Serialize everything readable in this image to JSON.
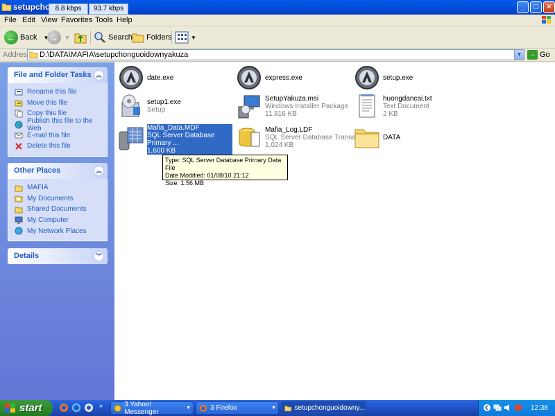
{
  "window": {
    "title": "setupchong",
    "speed_down": "8.8 kbps",
    "speed_up": "93.7 kbps"
  },
  "menu": [
    "File",
    "Edit",
    "View",
    "Favorites",
    "Tools",
    "Help"
  ],
  "toolbar": {
    "back": "Back",
    "search": "Search",
    "folders": "Folders"
  },
  "address": {
    "label": "Address",
    "path": "D:\\DATA\\MAFIA\\setupchonguoidownyakuza",
    "go": "Go"
  },
  "file_tasks": {
    "title": "File and Folder Tasks",
    "items": [
      "Rename this file",
      "Move this file",
      "Copy this file",
      "Publish this file to the Web",
      "E-mail this file",
      "Delete this file"
    ]
  },
  "other_places": {
    "title": "Other Places",
    "items": [
      "MAFIA",
      "My Documents",
      "Shared Documents",
      "My Computer",
      "My Network Places"
    ]
  },
  "details": {
    "title": "Details"
  },
  "files": [
    {
      "name": "date.exe",
      "sub1": "",
      "sub2": ""
    },
    {
      "name": "express.exe",
      "sub1": "",
      "sub2": ""
    },
    {
      "name": "setup.exe",
      "sub1": "",
      "sub2": ""
    },
    {
      "name": "setup1.exe",
      "sub1": "Setup",
      "sub2": ""
    },
    {
      "name": "SetupYakuza.msi",
      "sub1": "Windows Installer Package",
      "sub2": "11,816 KB"
    },
    {
      "name": "huongdancai.txt",
      "sub1": "Text Document",
      "sub2": "2 KB"
    },
    {
      "name": "Mafia_Data.MDF",
      "sub1": "SQL Server Database Primary ...",
      "sub2": "1,600 KB"
    },
    {
      "name": "Mafia_Log.LDF",
      "sub1": "SQL Server Database Transac...",
      "sub2": "1,024 KB"
    },
    {
      "name": "DATA",
      "sub1": "",
      "sub2": ""
    }
  ],
  "tooltip": {
    "type": "Type: SQL Server Database Primary Data File",
    "modified": "Date Modified: 01/08/10 21:12",
    "size": "Size: 1.56 MB"
  },
  "taskbar": {
    "start": "start",
    "buttons": [
      "3 Yahoo! Messenger",
      "3 Firefox",
      "setupchonguoidowny..."
    ],
    "clock": "12:38"
  }
}
